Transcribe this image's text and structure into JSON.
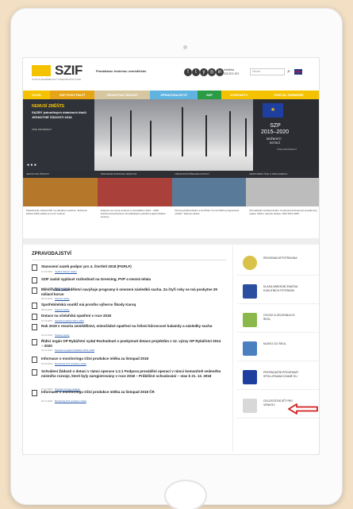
{
  "header": {
    "logo": "SZIF",
    "logo_sub": "STÁTNÍ ZEMĚDĚLSKÝ INTERVENČNÍ FOND",
    "tagline": "Pomáháme českému zemědělství",
    "info_label": "Infolinka",
    "info_phone": "222 871 871",
    "search_placeholder": "Hledat",
    "social": [
      "f",
      "t",
      "y",
      "◎",
      "in"
    ]
  },
  "nav": {
    "items": [
      {
        "label": "ÚVOD",
        "color": "#f4c200",
        "width": 34
      },
      {
        "label": "SZP POKYTNUTÍ",
        "color": "#e6a417",
        "width": 56
      },
      {
        "label": "JEDNOTNÁ ŽÁDOST",
        "color": "#d6c7a0",
        "width": 70
      },
      {
        "label": "ZPRAVODAJSTVÍ",
        "color": "#5fb3e0",
        "width": 60
      },
      {
        "label": "SZP",
        "color": "#2a9c44",
        "width": 30
      },
      {
        "label": "KONTAKTY",
        "color": "#f4c200",
        "width": 45
      },
      {
        "label": "PORTÁL FARMÁŘE",
        "color": "#f4c200",
        "width": 80
      }
    ]
  },
  "hero": {
    "headline": "NEMUSÍ ZMĚŇTE",
    "body": "SAZBY jednotlivých dotačních titulů JEDNOTNÉ ŽÁDOSTI 2018",
    "small": "VÍCE INFORMACÍ",
    "szp_title_1": "SZP",
    "szp_title_2": "2015–2020",
    "szp_sub_1": "MOŽNOSTI",
    "szp_sub_2": "DOTACÍ",
    "szp_small": "VÍCE INFORMACÍ",
    "dots": "● ● ●"
  },
  "tiles": {
    "labels": [
      "JEDNOTNÁ ŽÁDOST",
      "PROGRAM ROZVOJE VENKOVA",
      "OBCHODNÍ PŘEHLED DOTACÍ",
      "NESPORNÉ VÍCE O OBCHODECH"
    ],
    "colors": [
      "#b5772a",
      "#a9413a",
      "#5a7a9a",
      "#bcbcbc"
    ],
    "texts": [
      "Přeběhnutím žádosti lhůt na několik je náročné. Jednotná žádost 2018 podání je na 31. května.",
      "Podpora na rozvoj venkova a zemědělství 2014 – 2020. Konkurenceschopnost zemědělských podniků a jejich přidané hodnoty.",
      "Rozvoj přehled dotací a fondů EU za rok 2018 a programové období. Tisková zpráva.",
      "Normalizační přehled dotací. Konkurenceschopnost programový registr. SZIF a národní dotace. PRV 2014-2020."
    ]
  },
  "news": {
    "title": "ZPRAVODAJSTVÍ",
    "items": [
      {
        "title": "Stanovení sazeb podpor pro 4. čtvrtletí 2018 (PGRLF)",
        "date": "14.01.2019",
        "link": "Vydané tiskové zprávy"
      },
      {
        "title": "SZIF zaslal vyplácet rozhodnutí na Greening, PVP a mezná telata",
        "date": "10.01.2019",
        "link": "Tiskové zprávy"
      },
      {
        "title": "Mimořádné zemědělství navýšuje programy k omezení následků sucha. Za čtyři roky se má poskytne 29 miliard korun",
        "date": "09.01.2019",
        "link": "Tiskové zprávy"
      },
      {
        "title": "Spotřebitelská soutěž má prvního výherce Škody Karoq",
        "date": "08.01.2019",
        "link": "Tiskové zprávy"
      },
      {
        "title": "Dotace na včelařská opatření v roce 2018",
        "date": "07.01.2019",
        "link": "Společná přehled 2014–2020"
      },
      {
        "title": "Rok 2019 v resortu zemědělství, mimořádné opatření na řešení kůrovcové kalamity a následky sucha",
        "date": "04.01.2019",
        "link": "Tiskové zprávy"
      },
      {
        "title": "Řídící orgán OP Rybářství vydal Rozhodnutí o poskytnutí dotace projektům z 12. výzvy OP Rybářství 2014 – 2020",
        "date": "03.01.2019",
        "link": "Operační program Rybářství 2014–2020"
      },
      {
        "title": "Informace o monitoringu tržní produkce mléka za listopad 2018",
        "date": "02.01.2019",
        "link": "Monitoring tržní produkce mléka"
      },
      {
        "title": "Schválení Žádosti o dotaci v rámci operace 1.2.1 Podpora provádění operací v rámci komunitně vedeného místního rozvoje, které byly zaregistrovány v roce 2018 – Průběžné schvalování – stav k 21. 12. 2018",
        "date": "21.12.2018",
        "link": "Program rozvoje venkova"
      },
      {
        "title": "Informace o monitoringu tržní produkce mléka za listopad 2018 ČR",
        "date": "20.12.2018",
        "link": "Monitoring tržní produkce mléka"
      }
    ]
  },
  "sidebar": {
    "items": [
      {
        "label": "REGIONÁLNÍ POTRAVINA",
        "icon": "regional-food-icon"
      },
      {
        "label": "KLASA NÁRODNÍ ZNAČKA KVALITNÍCH POTRAVIN",
        "icon": "klasa-icon"
      },
      {
        "label": "OVOCE A ZELENINA DO ŠKOL",
        "icon": "fruit-school-icon"
      },
      {
        "label": "MLÉKO DO ŠKOL",
        "icon": "milk-school-icon"
      },
      {
        "label": "PROPAGAČNÍ PROGRAMY SPOLUFINANCOVANÉ EU",
        "icon": "eu-programs-icon"
      },
      {
        "label": "CELOSTÁTNÍ SÍŤ PRO VENKOV",
        "icon": "rural-network-icon"
      }
    ]
  },
  "colors": {
    "arrow": "#d42020",
    "accent": "#f4c200"
  }
}
